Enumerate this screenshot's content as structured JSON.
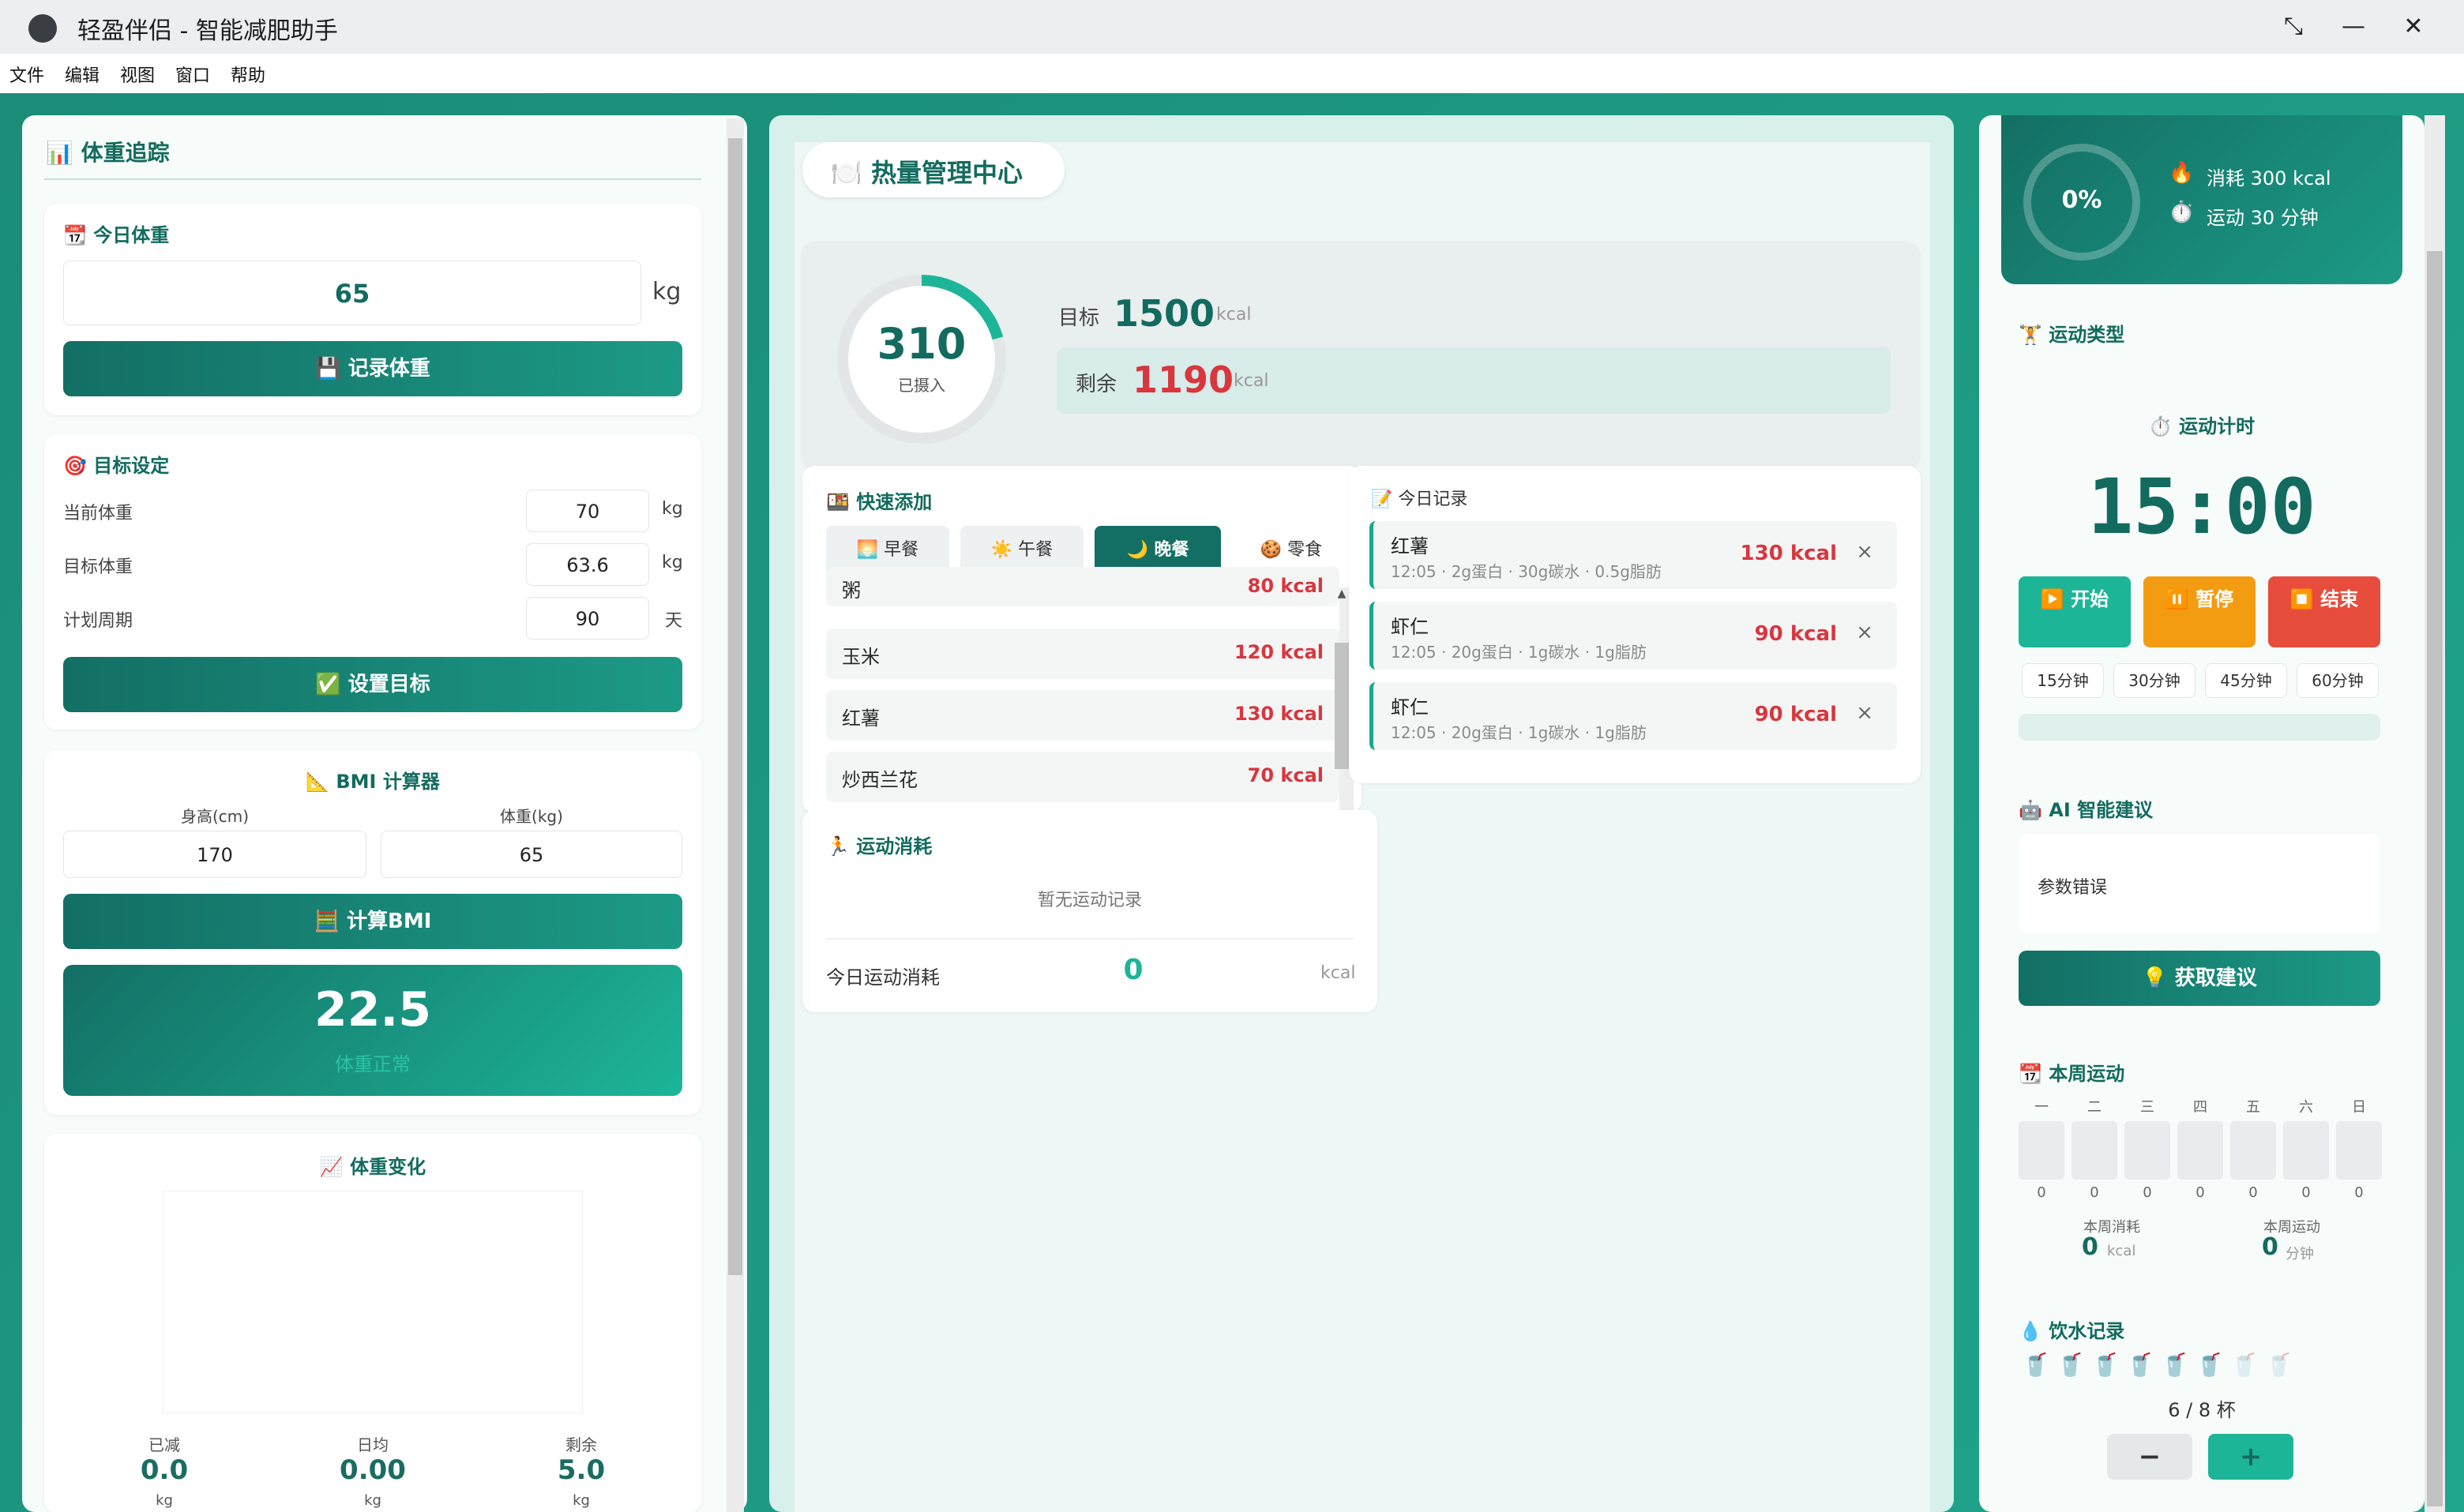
{
  "window": {
    "title": "轻盈伴侣 - 智能减肥助手"
  },
  "menu": [
    "文件",
    "编辑",
    "视图",
    "窗口",
    "帮助"
  ],
  "left": {
    "weight_tracking_title": "📊 体重追踪",
    "today_weight": {
      "title": "📆 今日体重",
      "value": "65",
      "unit": "kg",
      "button": "💾 记录体重"
    },
    "goal": {
      "title": "🎯 目标设定",
      "rows": [
        {
          "label": "当前体重",
          "value": "70",
          "unit": "kg"
        },
        {
          "label": "目标体重",
          "value": "63.6",
          "unit": "kg"
        },
        {
          "label": "计划周期",
          "value": "90",
          "unit": "天"
        }
      ],
      "button": "✅ 设置目标"
    },
    "bmi": {
      "title": "📐 BMI 计算器",
      "height_label": "身高(cm)",
      "height_value": "170",
      "weight_label": "体重(kg)",
      "weight_value": "65",
      "button": "🧮 计算BMI",
      "result": "22.5",
      "status": "体重正常"
    },
    "weight_change": {
      "title": "📈 体重变化",
      "stats": [
        {
          "label": "已减",
          "value": "0.0",
          "unit": "kg"
        },
        {
          "label": "日均",
          "value": "0.00",
          "unit": "kg"
        },
        {
          "label": "剩余",
          "value": "5.0",
          "unit": "kg"
        }
      ]
    }
  },
  "center": {
    "title": "🍽️ 热量管理中心",
    "ring": {
      "value": "310",
      "label": "已摄入",
      "progress": 0.207
    },
    "target_label": "目标",
    "target_value": "1500",
    "target_unit": "kcal",
    "remain_label": "剩余",
    "remain_value": "1190",
    "remain_unit": "kcal",
    "quick_add": {
      "title": "🍱 快速添加",
      "tabs": [
        "🌅 早餐",
        "☀️ 午餐",
        "🌙 晚餐",
        "🍪 零食"
      ],
      "active_tab": 2,
      "foods": [
        {
          "name": "粥",
          "kcal": "80 kcal"
        },
        {
          "name": "玉米",
          "kcal": "120 kcal"
        },
        {
          "name": "红薯",
          "kcal": "130 kcal"
        },
        {
          "name": "炒西兰花",
          "kcal": "70 kcal"
        }
      ]
    },
    "today_records": {
      "title": "📝 今日记录",
      "items": [
        {
          "name": "红薯",
          "meta": "12:05 · 2g蛋白 · 30g碳水 · 0.5g脂肪",
          "kcal": "130 kcal"
        },
        {
          "name": "虾仁",
          "meta": "12:05 · 20g蛋白 · 1g碳水 · 1g脂肪",
          "kcal": "90 kcal"
        },
        {
          "name": "虾仁",
          "meta": "12:05 · 20g蛋白 · 1g碳水 · 1g脂肪",
          "kcal": "90 kcal"
        }
      ]
    },
    "exercise": {
      "title": "🏃 运动消耗",
      "empty": "暂无运动记录",
      "total_label": "今日运动消耗",
      "total_value": "0",
      "total_unit": "kcal"
    }
  },
  "right": {
    "summary": {
      "percent": "0%",
      "burn": "消耗 300 kcal",
      "duration": "运动 30 分钟"
    },
    "exercise_type_title": "🏋️ 运动类型",
    "timer": {
      "title": "⏱️ 运动计时",
      "display": "15:00",
      "buttons": [
        "▶️ 开始",
        "⏸️ 暂停",
        "⏹️ 结束"
      ],
      "presets": [
        "15分钟",
        "30分钟",
        "45分钟",
        "60分钟"
      ],
      "progress": 0
    },
    "ai": {
      "title": "🤖 AI 智能建议",
      "content": "参数错误",
      "button": "💡 获取建议"
    },
    "week": {
      "title": "📆 本周运动",
      "days": [
        "一",
        "二",
        "三",
        "四",
        "五",
        "六",
        "日"
      ],
      "values": [
        "0",
        "0",
        "0",
        "0",
        "0",
        "0",
        "0"
      ],
      "burn_label": "本周消耗",
      "burn_value": "0",
      "burn_unit": "kcal",
      "time_label": "本周运动",
      "time_value": "0",
      "time_unit": "分钟"
    },
    "water": {
      "title": "💧 饮水记录",
      "filled": 6,
      "total": 8,
      "text": "6 / 8 杯",
      "minus": "−",
      "plus": "+"
    }
  },
  "colors": {
    "accent": "#1c9a86",
    "danger": "#d9363e",
    "warning": "#f39c12"
  }
}
